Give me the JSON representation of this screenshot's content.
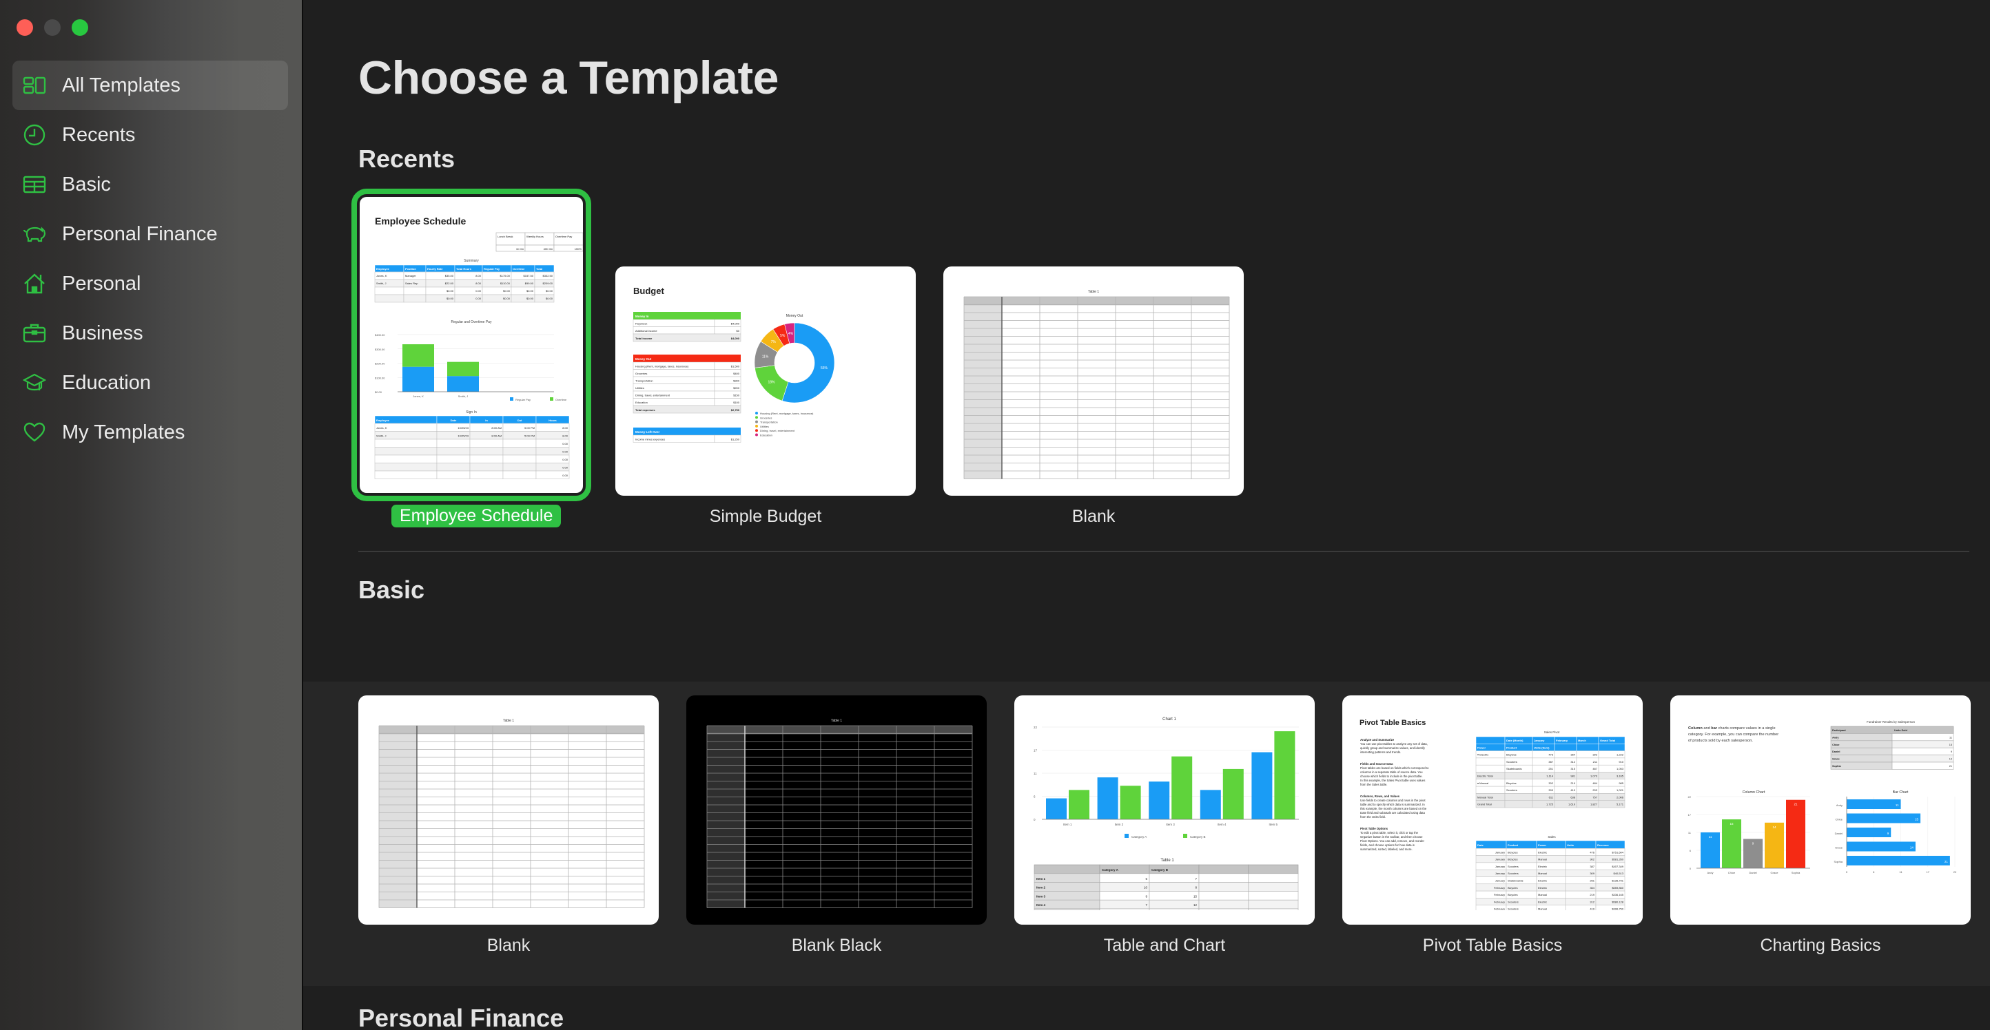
{
  "window": {
    "controls": [
      "close",
      "minimize",
      "zoom"
    ]
  },
  "sidebar": {
    "accent": "#2fc043",
    "items": [
      {
        "label": "All Templates",
        "icon": "grid-icon",
        "active": true
      },
      {
        "label": "Recents",
        "icon": "clock-icon",
        "active": false
      },
      {
        "label": "Basic",
        "icon": "table-icon",
        "active": false
      },
      {
        "label": "Personal Finance",
        "icon": "piggy-bank-icon",
        "active": false
      },
      {
        "label": "Personal",
        "icon": "house-icon",
        "active": false
      },
      {
        "label": "Business",
        "icon": "briefcase-icon",
        "active": false
      },
      {
        "label": "Education",
        "icon": "graduation-cap-icon",
        "active": false
      },
      {
        "label": "My Templates",
        "icon": "heart-icon",
        "active": false
      }
    ]
  },
  "main": {
    "title": "Choose a Template",
    "sections": [
      {
        "title": "Recents",
        "templates": [
          {
            "label": "Employee Schedule",
            "selected": true
          },
          {
            "label": "Simple Budget",
            "selected": false
          },
          {
            "label": "Blank",
            "selected": false
          }
        ]
      },
      {
        "title": "Basic",
        "templates": [
          {
            "label": "Blank",
            "selected": false
          },
          {
            "label": "Blank Black",
            "selected": false
          },
          {
            "label": "Table and Chart",
            "selected": false
          },
          {
            "label": "Pivot Table Basics",
            "selected": false
          },
          {
            "label": "Charting Basics",
            "selected": false
          }
        ]
      },
      {
        "title": "Personal Finance",
        "templates": []
      }
    ]
  },
  "thumbnails": {
    "employee_schedule": {
      "title": "Employee Schedule",
      "info_headers": [
        "Lunch Break",
        "Weekly Hours",
        "Overtime Pay"
      ],
      "info_values": [
        "1h 0m",
        "40h 0m",
        "150%"
      ],
      "summary_title": "Summary",
      "summary_headers": [
        "Employee",
        "Position",
        "Hourly Rate",
        "Total Hours",
        "Regular Pay",
        "Overtime",
        "Total"
      ],
      "summary_rows": [
        [
          "Jones, K",
          "Manager",
          "$35.00",
          "8.00",
          "$175.00",
          "$157.50",
          "$332.50"
        ],
        [
          "Smith, J",
          "Sales Rep",
          "$22.00",
          "8.00",
          "$110.00",
          "$99.00",
          "$209.00"
        ],
        [
          "",
          "",
          "$0.00",
          "0.00",
          "$0.00",
          "$0.00",
          "$0.00"
        ],
        [
          "",
          "",
          "$0.00",
          "0.00",
          "$0.00",
          "$0.00",
          "$0.00"
        ]
      ],
      "chart_title": "Regular and Overtime Pay",
      "chart_yticks": [
        "$400.00",
        "$300.00",
        "$200.00",
        "$100.00",
        "$0.00"
      ],
      "chart_categories": [
        "Jones, K",
        "Smith, J"
      ],
      "chart_regular": [
        175,
        110
      ],
      "chart_overtime": [
        157.5,
        99
      ],
      "chart_legend": [
        "Regular Pay",
        "Overtime"
      ],
      "signin_title": "Sign In",
      "signin_headers": [
        "Employee",
        "Date",
        "In",
        "Out",
        "Hours"
      ],
      "signin_rows": [
        [
          "Jones, K",
          "10/25/23",
          "8:00 AM",
          "5:00 PM",
          "8.00"
        ],
        [
          "Smith, J",
          "10/25/23",
          "8:00 AM",
          "5:00 PM",
          "8.00"
        ],
        [
          "",
          "",
          "",
          "",
          "0.00"
        ],
        [
          "",
          "",
          "",
          "",
          "0.00"
        ],
        [
          "",
          "",
          "",
          "",
          "0.00"
        ],
        [
          "",
          "",
          "",
          "",
          "0.00"
        ],
        [
          "",
          "",
          "",
          "",
          "0.00"
        ]
      ]
    },
    "simple_budget": {
      "title": "Budget",
      "money_in": {
        "header": "Money In",
        "rows": [
          [
            "Paycheck",
            "$4,000"
          ],
          [
            "Additional income",
            "$0"
          ]
        ],
        "total": [
          "Total income",
          "$4,000"
        ]
      },
      "money_out": {
        "header": "Money Out",
        "rows": [
          [
            "Housing (Rent, mortgage, taxes, insurance)",
            "$1,500"
          ],
          [
            "Groceries",
            "$400"
          ],
          [
            "Transportation",
            "$300"
          ],
          [
            "Utilities",
            "$200"
          ],
          [
            "Dining, travel, entertainment",
            "$150"
          ],
          [
            "Education",
            "$100"
          ]
        ],
        "total": [
          "Total expenses",
          "$2,750"
        ]
      },
      "left_over": {
        "header": "Money Left Over",
        "rows": [
          [
            "Income minus expenses",
            "$1,250"
          ]
        ]
      },
      "chart_title": "Money Out",
      "slices": [
        {
          "label": "Housing (Rent, mortgage, taxes, insurance)",
          "pct": 55,
          "color": "#1a9cf5"
        },
        {
          "label": "Groceries",
          "pct": 18,
          "color": "#5fd33b"
        },
        {
          "label": "Transportation",
          "pct": 11,
          "color": "#8e8e8e"
        },
        {
          "label": "Utilities",
          "pct": 7,
          "color": "#f5b614"
        },
        {
          "label": "Dining, travel, entertainment",
          "pct": 5,
          "color": "#f52a14"
        },
        {
          "label": "Education",
          "pct": 4,
          "color": "#d6247f"
        }
      ]
    },
    "blank": {
      "table_title": "Table 1"
    },
    "blank_black": {
      "table_title": "Table 1"
    },
    "table_and_chart": {
      "chart_title": "Chart 1",
      "yticks": [
        "22",
        "17",
        "11",
        "6",
        "0"
      ],
      "categories": [
        "Item 1",
        "Item 2",
        "Item 3",
        "Item 4",
        "Item 5"
      ],
      "series": [
        {
          "name": "Category A",
          "values": [
            5,
            10,
            9,
            7,
            16
          ],
          "color": "#1a9cf5"
        },
        {
          "name": "Category B",
          "values": [
            7,
            8,
            15,
            12,
            21
          ],
          "color": "#5fd33b"
        }
      ],
      "table_title": "Table 1",
      "table_headers": [
        "",
        "Category A",
        "Category B",
        "",
        ""
      ],
      "table_rows": [
        [
          "Item 1",
          "5",
          "7"
        ],
        [
          "Item 2",
          "10",
          "8"
        ],
        [
          "Item 3",
          "9",
          "15"
        ],
        [
          "Item 4",
          "7",
          "12"
        ]
      ]
    },
    "pivot_table_basics": {
      "title": "Pivot Table Basics",
      "paragraphs": [
        {
          "heading": "Analyze and Summarize",
          "body": "You can use pivot tables to analyze any set of data, quickly group and summarize values, and identify interesting patterns and trends."
        },
        {
          "heading": "Fields and Source Data",
          "body": "Pivot tables are based on fields which correspond to columns in a separate table of source data. You choose which fields to include in the pivot table. In this example, the Sales Pivot table uses values from the Sales table."
        },
        {
          "heading": "Columns, Rows, and Values",
          "body": "Use fields to create columns and rows in the pivot table and to specify which data is summarized. In this example, the month columns are based on the Date field and subtotals are calculated using data from the Units field."
        },
        {
          "heading": "Pivot Table Options",
          "body": "To edit a pivot table, select it, click or tap the Organize button in the toolbar, and then choose Pivot Options. You can add, remove, and reorder fields, and choose options for how data is summarized, sorted, labeled, and more."
        }
      ],
      "pivot_title": "Sales Pivot",
      "pivot_header1": [
        "",
        "Date (Month)",
        "January",
        "February",
        "March",
        "Grand Total"
      ],
      "pivot_header2": [
        "Power",
        "Product",
        "Units (Sum)",
        "",
        "",
        ""
      ],
      "pivot_rows": [
        [
          "▾ Electric",
          "Bicycles",
          "476",
          "354",
          "392",
          "1,222"
        ],
        [
          "",
          "Scooters",
          "387",
          "312",
          "211",
          "910"
        ],
        [
          "",
          "Skateboards",
          "251",
          "315",
          "487",
          "1,053"
        ],
        [
          "Electric Total",
          "",
          "1,114",
          "981",
          "1,070",
          "3,165"
        ],
        [
          "▾ Manual",
          "Bicycles",
          "302",
          "219",
          "484",
          "985"
        ],
        [
          "",
          "Scooters",
          "309",
          "419",
          "293",
          "1,021"
        ],
        [
          "Manual Total",
          "",
          "611",
          "638",
          "757",
          "2,006"
        ],
        [
          "Grand Total",
          "",
          "1,725",
          "1,619",
          "1,827",
          "5,171"
        ]
      ],
      "sales_title": "Sales",
      "sales_headers": [
        "Date",
        "Product",
        "Power",
        "Units",
        "Revenue"
      ],
      "sales_rows": [
        [
          "January",
          "Bicycles",
          "Electric",
          "476",
          "$751,604"
        ],
        [
          "January",
          "Bicycles",
          "Manual",
          "302",
          "$581,350"
        ],
        [
          "January",
          "Scooters",
          "Electric",
          "387",
          "$407,349"
        ],
        [
          "January",
          "Scooters",
          "Manual",
          "309",
          "$40,513"
        ],
        [
          "January",
          "Skateboards",
          "Electric",
          "251",
          "$135,791"
        ],
        [
          "February",
          "Bicycles",
          "Electric",
          "354",
          "$559,860"
        ],
        [
          "February",
          "Bicycles",
          "Manual",
          "219",
          "$336,165"
        ],
        [
          "February",
          "Scooters",
          "Electric",
          "312",
          "$580,128"
        ],
        [
          "February",
          "Scooters",
          "Manual",
          "419",
          "$396,750"
        ]
      ]
    },
    "charting_basics": {
      "intro_bold1": "Column",
      "intro_mid": " and ",
      "intro_bold2": "bar",
      "intro_rest": " charts compare values in a single category. For example, you can compare the number of products sold by each salesperson.",
      "table_title": "Fundraiser Results by Salesperson",
      "table_headers": [
        "Participant",
        "Units Sold"
      ],
      "people": [
        "Andy",
        "Chloe",
        "Daniel",
        "Grace",
        "Sophia"
      ],
      "values": [
        11,
        15,
        9,
        14,
        21
      ],
      "column_colors": [
        "#1a9cf5",
        "#5fd33b",
        "#8e8e8e",
        "#f5b614",
        "#f52a14"
      ],
      "column_title": "Column Chart",
      "bar_title": "Bar Chart",
      "ticks": [
        "0",
        "6",
        "11",
        "17",
        "22"
      ]
    }
  }
}
